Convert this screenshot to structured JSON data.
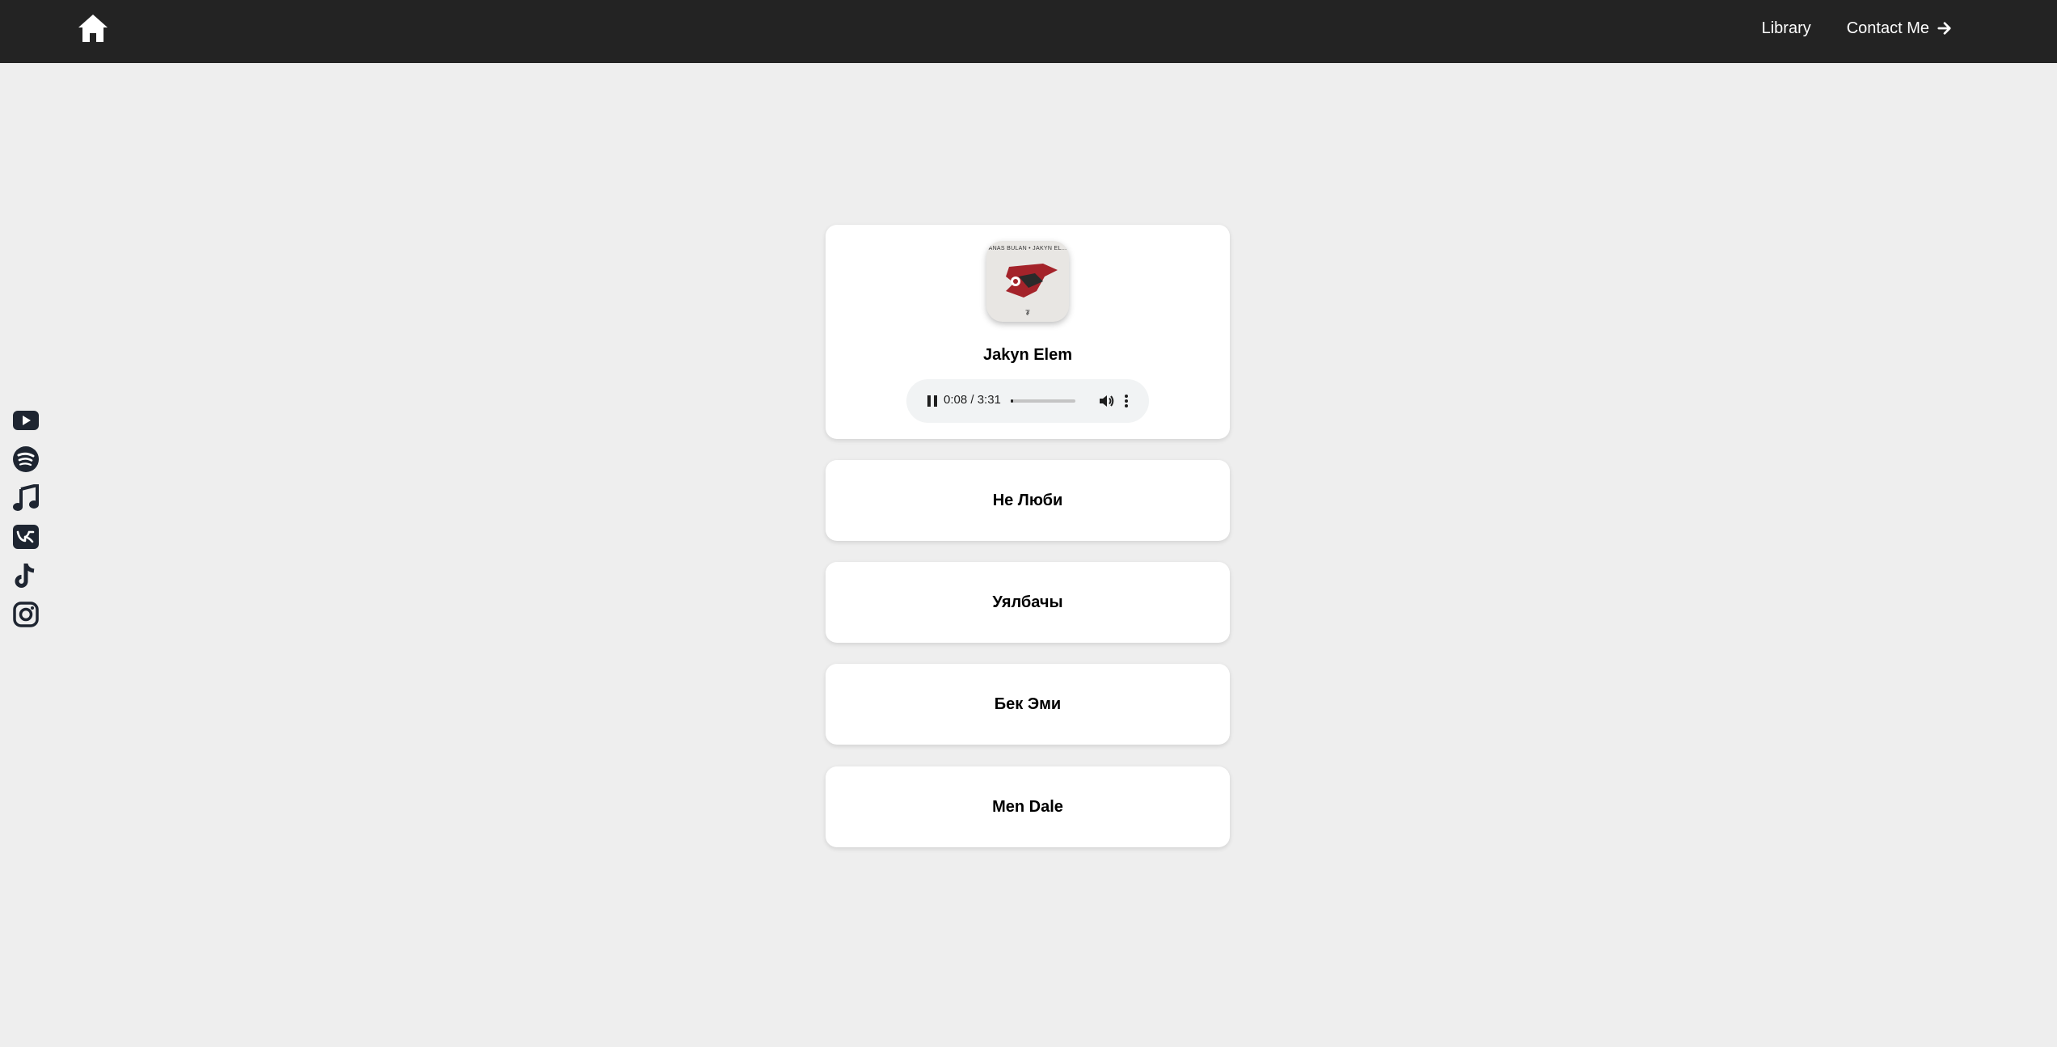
{
  "nav": {
    "home_icon": "home-icon",
    "links": [
      {
        "label": "Library"
      },
      {
        "label": "Contact Me",
        "icon": "arrow-right-icon"
      }
    ]
  },
  "social_icons": [
    "youtube-icon",
    "spotify-icon",
    "music-note-icon",
    "vk-icon",
    "tiktok-icon",
    "instagram-icon"
  ],
  "player": {
    "cover_text": "ANAS BULAN • JAKYN EL...",
    "cover_mark": "₮",
    "title": "Jakyn Elem",
    "time": "0:08 / 3:31",
    "progress": 0.038
  },
  "songs": [
    {
      "title": "Не Люби"
    },
    {
      "title": "Уялбачы"
    },
    {
      "title": "Бек Эми"
    },
    {
      "title": "Men Dale"
    }
  ],
  "colors": {
    "navbar": "#232323",
    "background": "#eeeeee",
    "card": "#ffffff",
    "cover_accent": "#a4232a"
  }
}
